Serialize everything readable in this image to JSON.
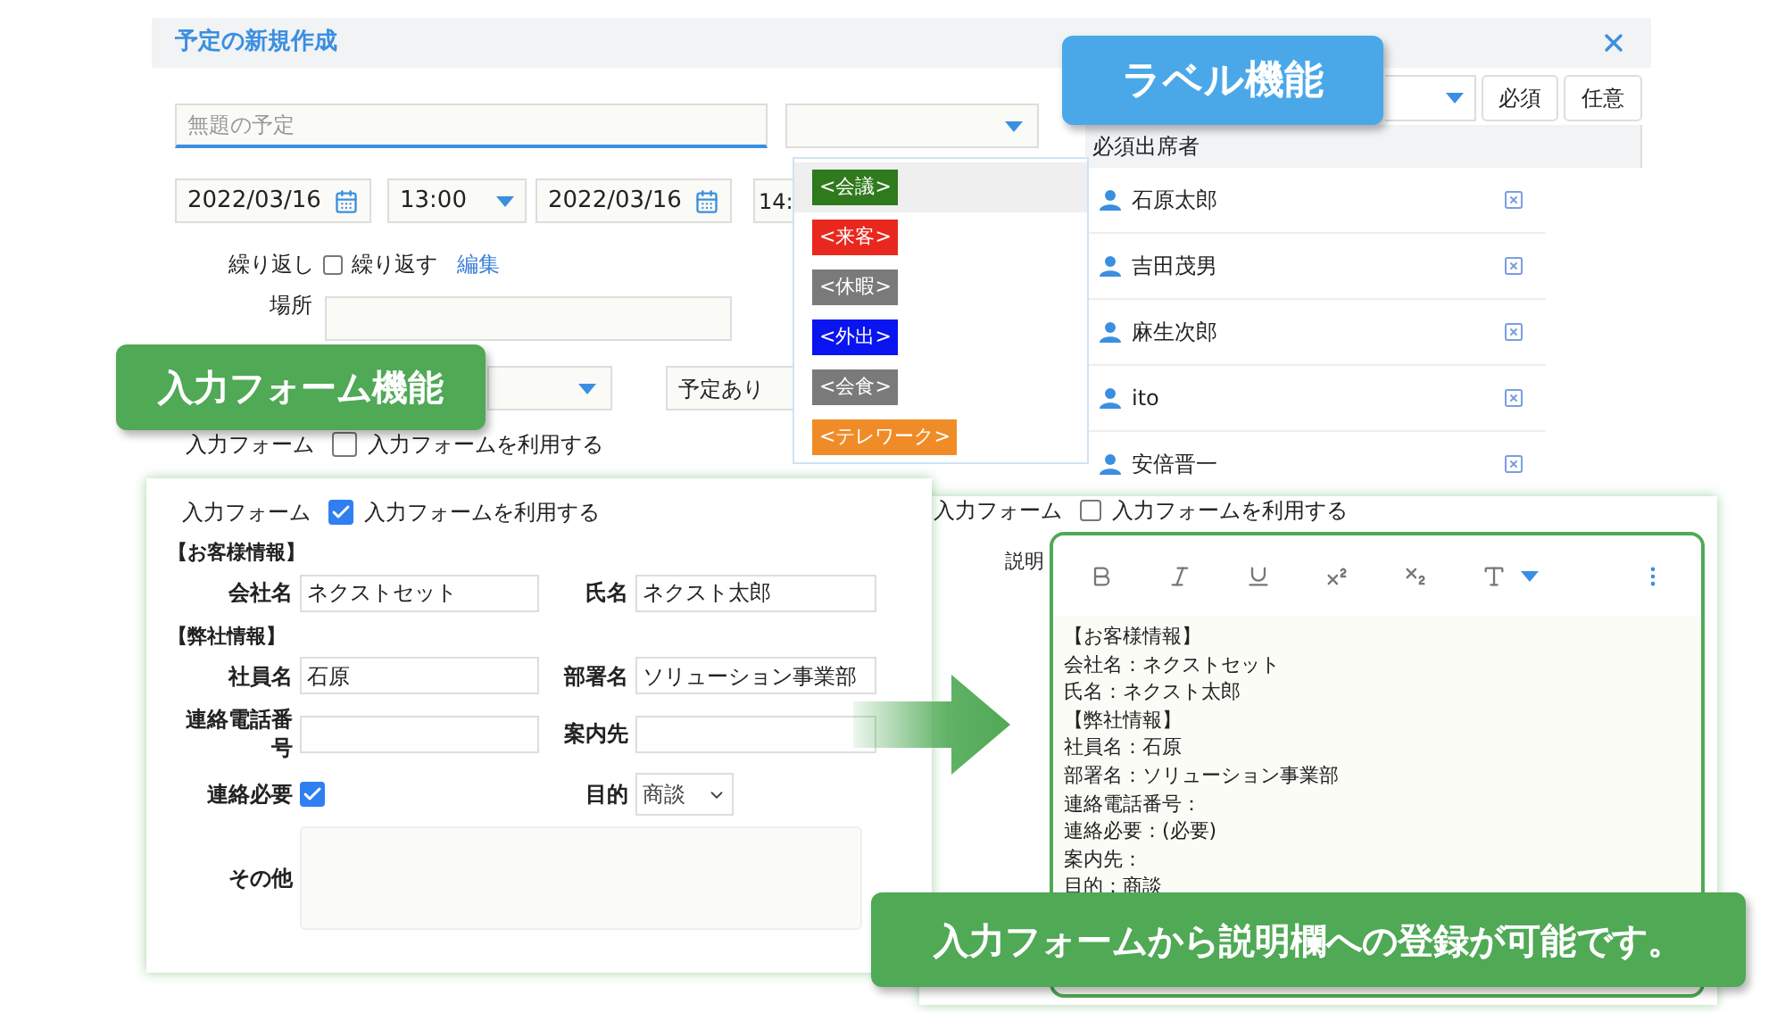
{
  "dialog": {
    "title": "予定の新規作成"
  },
  "title_field": {
    "placeholder": "無題の予定"
  },
  "schedule": {
    "start_date": "2022/03/16",
    "start_time": "13:00",
    "end_date": "2022/03/16",
    "end_time": "14:"
  },
  "repeat": {
    "label": "繰り返し",
    "checkbox_label": "繰り返す",
    "checked": false,
    "link": "編集"
  },
  "location": {
    "label": "場所"
  },
  "status_select": {
    "value": "予定あり"
  },
  "input_form": {
    "label": "入力フォーム",
    "checkbox_label": "入力フォームを利用する",
    "checked": false
  },
  "attendees": {
    "buttons": [
      {
        "label": "必須"
      },
      {
        "label": "任意"
      }
    ],
    "header": "必須出席者",
    "rows": [
      {
        "name": "石原太郎"
      },
      {
        "name": "吉田茂男"
      },
      {
        "name": "麻生次郎"
      },
      {
        "name": "ito"
      },
      {
        "name": "安倍晋一"
      }
    ]
  },
  "label_dropdown": {
    "items": [
      {
        "label": "<会議>",
        "color": "#2f7a1c",
        "selected": true
      },
      {
        "label": "<来客>",
        "color": "#e8281e",
        "selected": false
      },
      {
        "label": "<休暇>",
        "color": "#7a7a7a",
        "selected": false
      },
      {
        "label": "<外出>",
        "color": "#0a14f0",
        "selected": false
      },
      {
        "label": "<会食>",
        "color": "#7a7a7a",
        "selected": false
      },
      {
        "label": "<テレワーク>",
        "color": "#f08c28",
        "selected": false
      }
    ]
  },
  "form_panel": {
    "label": "入力フォーム",
    "checkbox_label": "入力フォームを利用する",
    "checked": true,
    "sections": [
      {
        "title": "【お客様情報】",
        "fields": [
          {
            "label": "会社名",
            "kind": "text",
            "value": "ネクストセット"
          },
          {
            "label": "氏名",
            "kind": "text",
            "value": "ネクスト太郎"
          }
        ]
      },
      {
        "title": "【弊社情報】",
        "fields": [
          {
            "label": "社員名",
            "kind": "text",
            "value": "石原"
          },
          {
            "label": "部署名",
            "kind": "text",
            "value": "ソリューション事業部"
          },
          {
            "label": "連絡電話番号",
            "kind": "text"
          },
          {
            "label": "案内先",
            "kind": "text"
          },
          {
            "label": "連絡必要",
            "kind": "check",
            "checked": true
          },
          {
            "label": "目的",
            "kind": "select",
            "value": "商談"
          },
          {
            "label": "その他",
            "kind": "textarea"
          }
        ]
      }
    ]
  },
  "editor_panel": {
    "label": "入力フォーム",
    "checkbox_label": "入力フォームを利用する",
    "checked": false,
    "description_label": "説明",
    "lines": [
      "【お客様情報】",
      "会社名：ネクストセット",
      "氏名：ネクスト太郎",
      "【弊社情報】",
      "社員名：石原",
      "部署名：ソリューション事業部",
      "連絡電話番号：",
      "連絡必要：(必要)",
      "案内先：",
      "目的：商談"
    ]
  },
  "callouts": [
    {
      "text": "ラベル機能",
      "color": "#4aa8e8"
    },
    {
      "text": "入力フォーム機能",
      "color": "#4fa955"
    },
    {
      "text": "入力フォームから説明欄への登録が可能です。",
      "color": "#4fa955"
    }
  ]
}
